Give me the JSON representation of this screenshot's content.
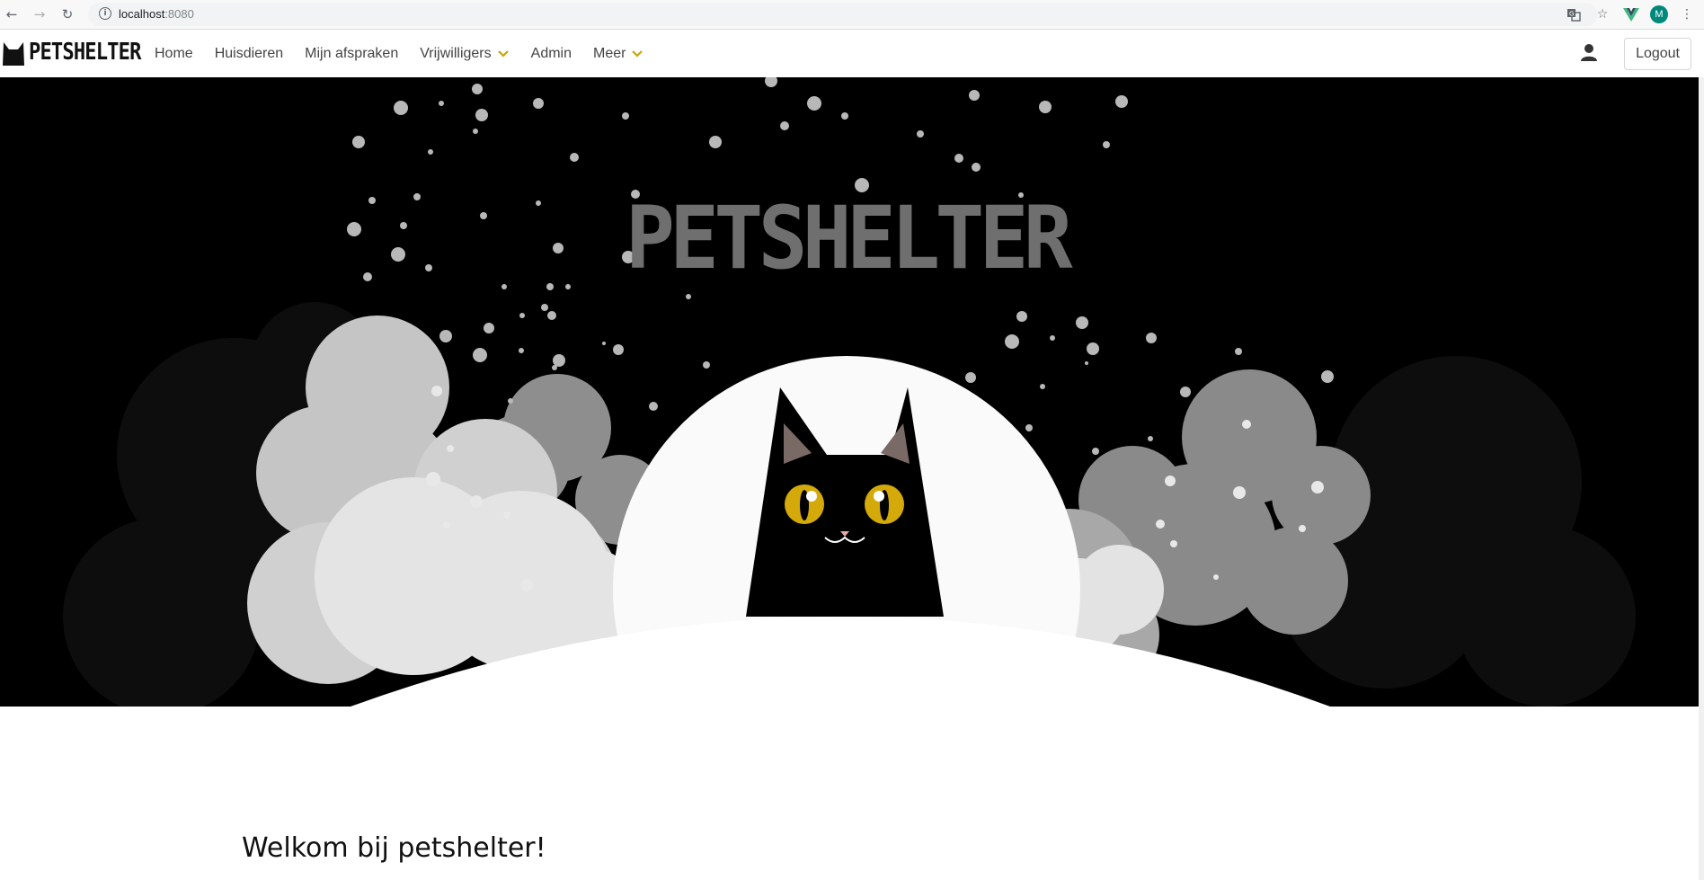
{
  "browser": {
    "url_host": "localhost",
    "url_port": ":8080",
    "avatar_letter": "M",
    "icons": [
      "back-icon",
      "forward-icon",
      "reload-icon",
      "info-icon",
      "translate-icon",
      "star-icon",
      "vue-devtools-icon",
      "profile-avatar",
      "menu-dots-icon"
    ]
  },
  "navbar": {
    "brand": "PETSHELTER",
    "items": [
      {
        "label": "Home",
        "dropdown": false
      },
      {
        "label": "Huisdieren",
        "dropdown": false
      },
      {
        "label": "Mijn afspraken",
        "dropdown": false
      },
      {
        "label": "Vrijwilligers",
        "dropdown": true
      },
      {
        "label": "Admin",
        "dropdown": false
      },
      {
        "label": "Meer",
        "dropdown": true
      }
    ],
    "logout_label": "Logout",
    "accent_color": "#c9a600"
  },
  "hero": {
    "title": "PETSHELTER",
    "background": "#000000",
    "moon_color": "#fafafa",
    "eye_color": "#d4a90a"
  },
  "main": {
    "welcome_title": "Welkom bij petshelter!"
  }
}
